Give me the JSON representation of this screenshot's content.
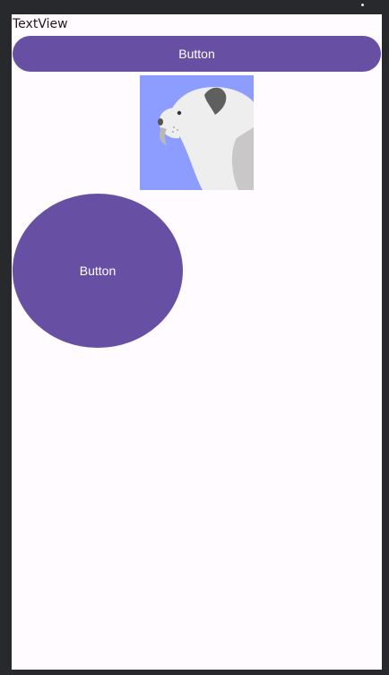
{
  "screen": {
    "textview_label": "TextView",
    "wide_button_label": "Button",
    "round_button_label": "Button",
    "image_icon": "dog-profile-image"
  },
  "colors": {
    "accent": "#6750a4",
    "background": "#fffbfe",
    "image_background": "#8c9cff"
  }
}
